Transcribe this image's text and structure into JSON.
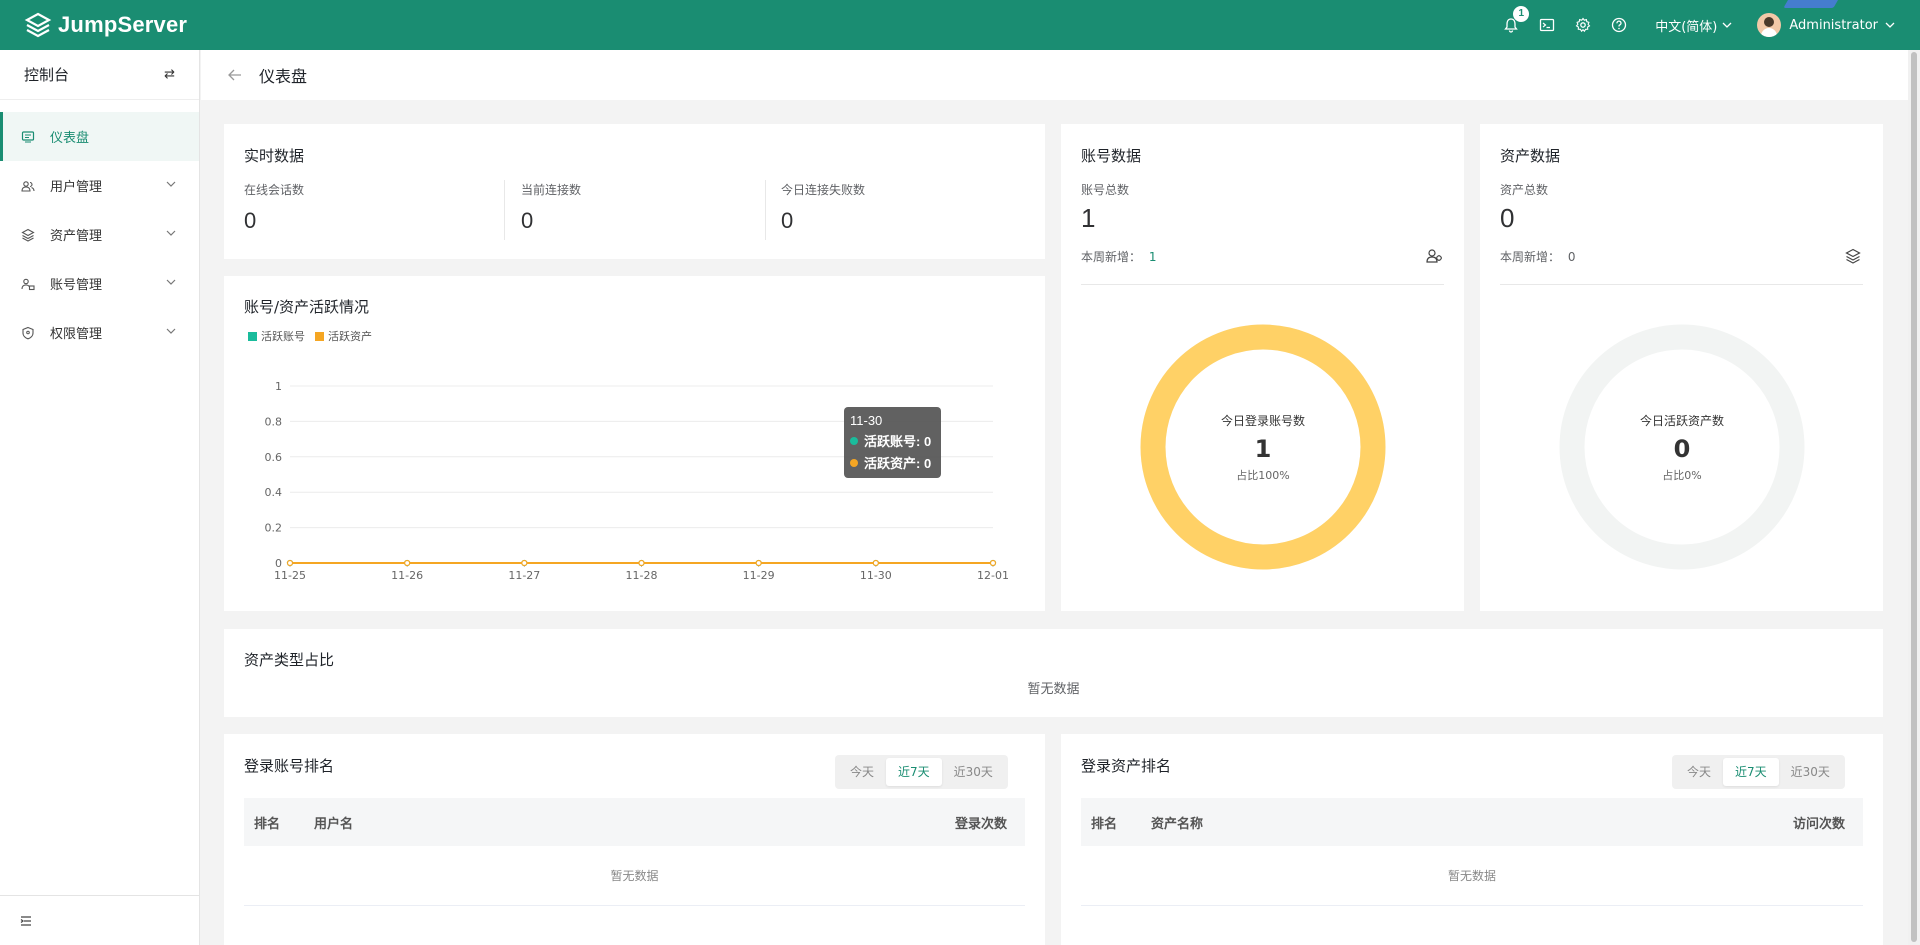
{
  "app": {
    "name": "JumpServer"
  },
  "topbar": {
    "notification_count": "1",
    "language": "中文(简体)",
    "username": "Administrator"
  },
  "sidebar": {
    "title": "控制台",
    "items": [
      {
        "label": "仪表盘",
        "icon": "dashboard-icon",
        "active": true
      },
      {
        "label": "用户管理",
        "icon": "users-icon"
      },
      {
        "label": "资产管理",
        "icon": "layers-icon"
      },
      {
        "label": "账号管理",
        "icon": "account-icon"
      },
      {
        "label": "权限管理",
        "icon": "shield-icon"
      }
    ]
  },
  "page": {
    "title": "仪表盘"
  },
  "realtime": {
    "title": "实时数据",
    "stats": [
      {
        "label": "在线会话数",
        "value": "0"
      },
      {
        "label": "当前连接数",
        "value": "0"
      },
      {
        "label": "今日连接失败数",
        "value": "0"
      }
    ]
  },
  "activity": {
    "title": "账号/资产活跃情况",
    "tooltip": {
      "date": "11-30",
      "rows": [
        "活跃账号: 0",
        "活跃资产: 0"
      ]
    }
  },
  "chart_data": {
    "type": "line",
    "title": "账号/资产活跃情况",
    "x": [
      "11-25",
      "11-26",
      "11-27",
      "11-28",
      "11-29",
      "11-30",
      "12-01"
    ],
    "series": [
      {
        "name": "活跃账号",
        "values": [
          0,
          0,
          0,
          0,
          0,
          0,
          0
        ],
        "color": "#1abc9c"
      },
      {
        "name": "活跃资产",
        "values": [
          0,
          0,
          0,
          0,
          0,
          0,
          0
        ],
        "color": "#f5a623"
      }
    ],
    "yticks": [
      "0",
      "0.2",
      "0.4",
      "0.6",
      "0.8",
      "1"
    ],
    "ylim": [
      0,
      1
    ],
    "grid": true,
    "legend": "top-left"
  },
  "accounts": {
    "title": "账号数据",
    "total_label": "账号总数",
    "total": "1",
    "week_label": "本周新增：",
    "week_value": "1",
    "ring_label": "今日登录账号数",
    "ring_value": "1",
    "ring_pct": "占比100%",
    "ring_fraction": 1.0,
    "ring_color": "#ffd166"
  },
  "assets": {
    "title": "资产数据",
    "total_label": "资产总数",
    "total": "0",
    "week_label": "本周新增：",
    "week_value": "0",
    "ring_label": "今日活跃资产数",
    "ring_value": "0",
    "ring_pct": "占比0%",
    "ring_fraction": 0.0,
    "ring_color": "#f2f4f3"
  },
  "asset_types": {
    "title": "资产类型占比",
    "empty": "暂无数据"
  },
  "login_rank": {
    "title": "登录账号排名",
    "tabs": [
      "今天",
      "近7天",
      "近30天"
    ],
    "active_tab": 1,
    "columns": [
      "排名",
      "用户名",
      "登录次数"
    ],
    "empty": "暂无数据"
  },
  "asset_rank": {
    "title": "登录资产排名",
    "tabs": [
      "今天",
      "近7天",
      "近30天"
    ],
    "active_tab": 1,
    "columns": [
      "排名",
      "资产名称",
      "访问次数"
    ],
    "empty": "暂无数据"
  }
}
